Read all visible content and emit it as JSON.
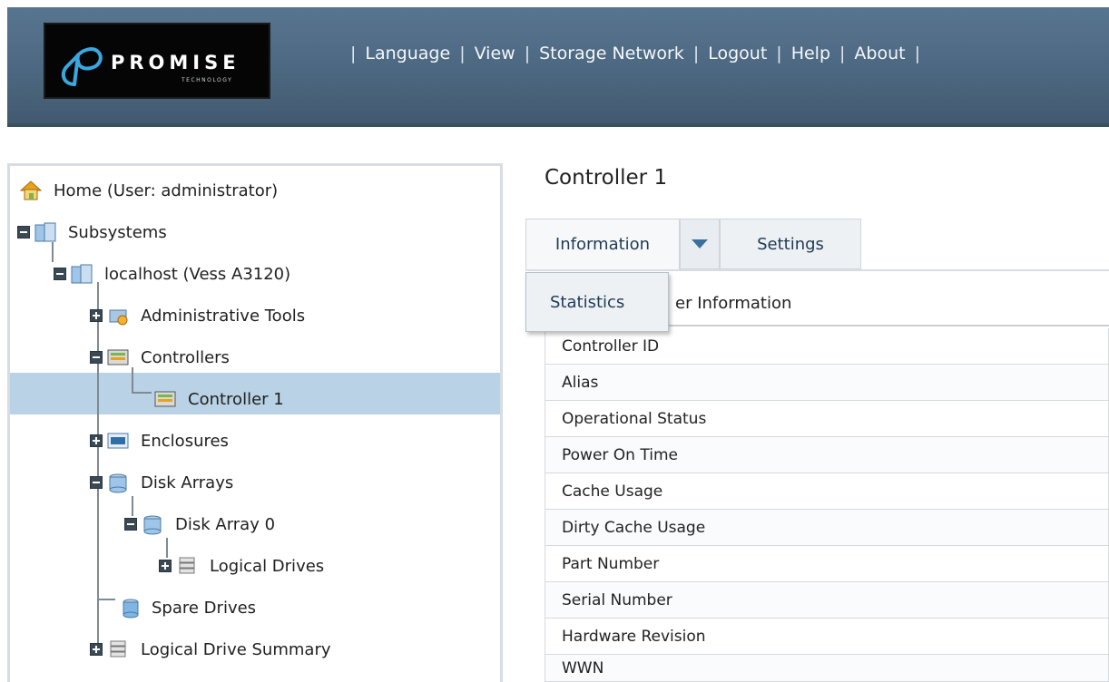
{
  "header": {
    "logo_word": "PROMISE",
    "logo_sub": "TECHNOLOGY",
    "nav": [
      "Language",
      "View",
      "Storage Network",
      "Logout",
      "Help",
      "About"
    ],
    "separator": "|"
  },
  "tree": {
    "items": [
      {
        "label": "Home (User: administrator)",
        "icon": "home-icon"
      },
      {
        "label": "Subsystems",
        "icon": "subsystems-icon"
      },
      {
        "label": "localhost (Vess A3120)",
        "icon": "server-icon"
      },
      {
        "label": "Administrative Tools",
        "icon": "admin-tools-icon"
      },
      {
        "label": "Controllers",
        "icon": "controllers-icon"
      },
      {
        "label": "Controller 1",
        "icon": "controller-icon",
        "selected": true
      },
      {
        "label": "Enclosures",
        "icon": "enclosure-icon"
      },
      {
        "label": "Disk Arrays",
        "icon": "disk-array-icon"
      },
      {
        "label": "Disk Array 0",
        "icon": "disk-array-icon"
      },
      {
        "label": "Logical Drives",
        "icon": "logical-drive-icon"
      },
      {
        "label": "Spare Drives",
        "icon": "spare-drive-icon"
      },
      {
        "label": "Logical Drive Summary",
        "icon": "logical-drive-icon"
      }
    ]
  },
  "main": {
    "title": "Controller 1",
    "tabs": {
      "information": "Information",
      "settings": "Settings"
    },
    "dropdown": {
      "statistics": "Statistics"
    },
    "panel_header": "er Information",
    "rows": [
      "Controller ID",
      "Alias",
      "Operational Status",
      "Power On Time",
      "Cache Usage",
      "Dirty Cache Usage",
      "Part Number",
      "Serial Number",
      "Hardware Revision",
      "WWN"
    ]
  },
  "colors": {
    "header_bg": "#4b667f",
    "selected_row": "#b9d2e6",
    "tab_text": "#1f3a55"
  }
}
